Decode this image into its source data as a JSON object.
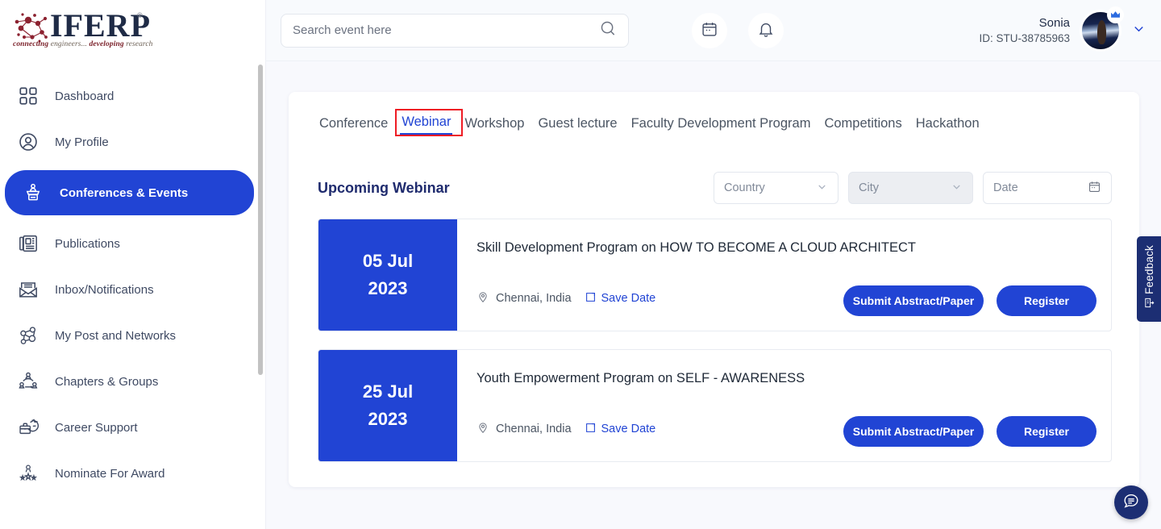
{
  "brand": {
    "name": "IFERP",
    "registered": "®",
    "tagline_1": "connecting",
    "tagline_2": " engineers... ",
    "tagline_3": "developing",
    "tagline_4": " research",
    "accent_blue": "#2144d4",
    "navy": "#1c2e73",
    "annotation_red": "#ee1c24"
  },
  "sidebar": {
    "items": [
      {
        "label": "Dashboard",
        "icon": "grid-icon",
        "active": false
      },
      {
        "label": "My Profile",
        "icon": "user-circle-icon",
        "active": false
      },
      {
        "label": "Conferences & Events",
        "icon": "podium-icon",
        "active": true
      },
      {
        "label": "Publications",
        "icon": "newspaper-icon",
        "active": false
      },
      {
        "label": "Inbox/Notifications",
        "icon": "envelope-icon",
        "active": false
      },
      {
        "label": "My Post and Networks",
        "icon": "network-icon",
        "active": false
      },
      {
        "label": "Chapters & Groups",
        "icon": "group-icon",
        "active": false
      },
      {
        "label": "Career Support",
        "icon": "briefcase-icon",
        "active": false
      },
      {
        "label": "Nominate For Award",
        "icon": "award-icon",
        "active": false
      }
    ]
  },
  "topbar": {
    "search": {
      "value": "",
      "placeholder": "Search event here",
      "icon": "search-icon"
    },
    "calendar_icon": "calendar-icon",
    "bell_icon": "bell-icon",
    "user": {
      "name": "Sonia",
      "id": "ID: STU-38785963",
      "avatar": "user-avatar",
      "badge": "crown-icon",
      "chevron": "chevron-down-icon"
    }
  },
  "main": {
    "tabs": [
      {
        "label": "Conference",
        "active": false
      },
      {
        "label": "Webinar",
        "active": true,
        "highlighted": true
      },
      {
        "label": "Workshop",
        "active": false
      },
      {
        "label": "Guest lecture",
        "active": false
      },
      {
        "label": "Faculty Development Program",
        "active": false
      },
      {
        "label": "Competitions",
        "active": false
      },
      {
        "label": "Hackathon",
        "active": false
      }
    ],
    "section_title": "Upcoming Webinar",
    "filters": [
      {
        "label": "Country",
        "icon": "chevron-down-icon",
        "disabled": false
      },
      {
        "label": "City",
        "icon": "chevron-down-icon",
        "disabled": true
      },
      {
        "label": "Date",
        "icon": "calendar-icon",
        "disabled": false
      }
    ],
    "events": [
      {
        "day_month": "05 Jul",
        "year": "2023",
        "title": "Skill Development Program on HOW TO BECOME A CLOUD ARCHITECT",
        "location": "Chennai, India",
        "location_icon": "map-pin-icon",
        "save_date": "Save Date",
        "save_date_icon": "bookmark-icon",
        "submit_label": "Submit Abstract/Paper",
        "register_label": "Register"
      },
      {
        "day_month": "25 Jul",
        "year": "2023",
        "title": "Youth Empowerment Program on SELF - AWARENESS",
        "location": "Chennai, India",
        "location_icon": "map-pin-icon",
        "save_date": "Save Date",
        "save_date_icon": "bookmark-icon",
        "submit_label": "Submit Abstract/Paper",
        "register_label": "Register"
      }
    ]
  },
  "widgets": {
    "feedback_label": "Feedback",
    "feedback_icon": "feedback-icon",
    "chat_icon": "chat-bubble-icon"
  }
}
